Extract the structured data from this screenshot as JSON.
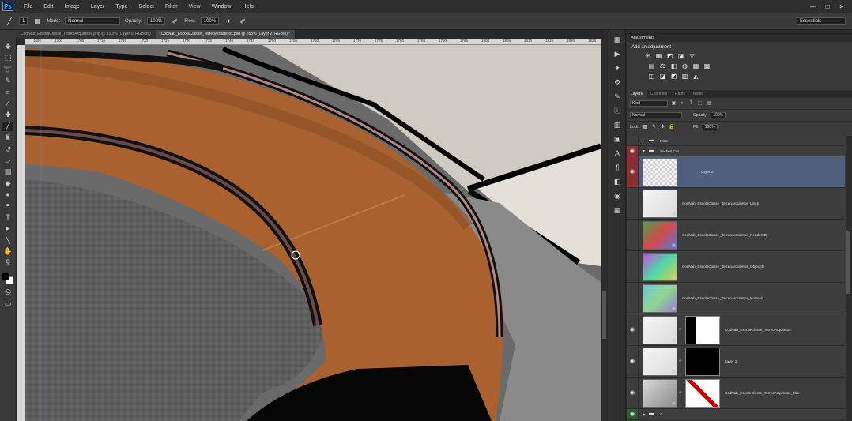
{
  "app": {
    "logo": "Ps",
    "menu": [
      "File",
      "Edit",
      "Image",
      "Layer",
      "Type",
      "Select",
      "Filter",
      "View",
      "Window",
      "Help"
    ],
    "window_controls": [
      "—",
      "□",
      "✕"
    ]
  },
  "options_bar": {
    "brush_size": "1",
    "mode_label": "Mode:",
    "mode_value": "Normal",
    "opacity_label": "Opacity:",
    "opacity_value": "100%",
    "flow_label": "Flow:",
    "flow_value": "100%",
    "workspace": "Essentials"
  },
  "tabs": [
    {
      "label": "CodNab_EscolaClasse_TerreoArquitetos.png @ 33.3% (Layer 0, RGB/8#)",
      "active": false
    },
    {
      "label": "CodNab_EscolaClasse_TerreoArquitetos.psd @ 855% (Layer 2, RGB/8) *",
      "active": true
    }
  ],
  "ruler_ticks": [
    "1695",
    "1700",
    "1705",
    "1710",
    "1715",
    "1720",
    "1725",
    "1730",
    "1735",
    "1740",
    "1745",
    "1750",
    "1755",
    "1760",
    "1765",
    "1770",
    "1775",
    "1780",
    "1785",
    "1790",
    "1795",
    "1800",
    "1805",
    "1810",
    "1815",
    "1820",
    "1825",
    "1830"
  ],
  "tools": [
    {
      "icon": "move-tool-icon",
      "glyph": "✥"
    },
    {
      "icon": "marquee-tool-icon",
      "glyph": "⬚"
    },
    {
      "icon": "lasso-tool-icon",
      "glyph": "➰"
    },
    {
      "icon": "quick-select-icon",
      "glyph": "✎"
    },
    {
      "icon": "crop-tool-icon",
      "glyph": "⌗"
    },
    {
      "icon": "eyedropper-icon",
      "glyph": "⁄"
    },
    {
      "icon": "healing-brush-icon",
      "glyph": "✚"
    },
    {
      "icon": "brush-tool-icon",
      "glyph": "╱",
      "active": true
    },
    {
      "icon": "clone-stamp-icon",
      "glyph": "♜"
    },
    {
      "icon": "history-brush-icon",
      "glyph": "↺"
    },
    {
      "icon": "eraser-icon",
      "glyph": "▱"
    },
    {
      "icon": "gradient-tool-icon",
      "glyph": "▤"
    },
    {
      "icon": "blur-tool-icon",
      "glyph": "◆"
    },
    {
      "icon": "dodge-tool-icon",
      "glyph": "●"
    },
    {
      "icon": "pen-tool-icon",
      "glyph": "✒"
    },
    {
      "icon": "type-tool-icon",
      "glyph": "T"
    },
    {
      "icon": "path-select-icon",
      "glyph": "▸"
    },
    {
      "icon": "line-tool-icon",
      "glyph": "╲"
    },
    {
      "icon": "hand-tool-icon",
      "glyph": "✋"
    },
    {
      "icon": "zoom-tool-icon",
      "glyph": "⚲"
    }
  ],
  "side_icons": [
    {
      "icon": "history-icon",
      "glyph": "▦"
    },
    {
      "icon": "actions-icon",
      "glyph": "▶"
    },
    {
      "icon": "brush-presets-icon",
      "glyph": "✦"
    },
    {
      "icon": "tool-presets-icon",
      "glyph": "⚙"
    },
    {
      "icon": "brush-panel-icon",
      "glyph": "✎"
    },
    {
      "icon": "info-icon",
      "glyph": "ⓘ"
    },
    {
      "icon": "layer-comps-icon",
      "glyph": "▥"
    },
    {
      "icon": "navigator-icon",
      "glyph": "▣"
    },
    {
      "icon": "character-icon",
      "glyph": "A"
    },
    {
      "icon": "paragraph-icon",
      "glyph": "¶"
    },
    {
      "icon": "styles-icon",
      "glyph": "◧"
    },
    {
      "icon": "clone-source-icon",
      "glyph": "◉"
    },
    {
      "icon": "swatches-icon",
      "glyph": "▦"
    }
  ],
  "adjustments": {
    "title": "Adjustments",
    "subtitle": "Add an adjustment",
    "row1": [
      "☀",
      "▦",
      "◩",
      "◪",
      "▽"
    ],
    "row2": [
      "▤",
      "⚖",
      "◧",
      "◍",
      "▦",
      "▩"
    ],
    "row3": [
      "◫",
      "◪",
      "◩",
      "▥",
      "◭"
    ]
  },
  "layers_panel": {
    "tabs": [
      {
        "label": "Layers",
        "active": true
      },
      {
        "label": "Channels",
        "active": false
      },
      {
        "label": "Paths",
        "active": false
      },
      {
        "label": "Notes",
        "active": false
      }
    ],
    "filter_kind": "Kind",
    "blend_mode": "Normal",
    "opacity_label": "Opacity:",
    "opacity_value": "100%",
    "lock_label": "Lock:",
    "fill_label": "Fill:",
    "fill_value": "100%",
    "layers": [
      {
        "name": "Root",
        "type": "group",
        "visible": false
      },
      {
        "name": "Section Cut",
        "type": "group",
        "visible": true,
        "red": true
      },
      {
        "name": "Layer 2",
        "type": "layer",
        "visible": true,
        "red": true,
        "selected": true,
        "thumb": "checker"
      },
      {
        "name": "CodNab_EscolaClasse_TerreoArquitetos_Lines",
        "type": "layer",
        "visible": false,
        "thumb": "lines"
      },
      {
        "name": "CodNab_EscolaClasse_TerreoArquitetos_Render3D",
        "type": "layer",
        "visible": false,
        "thumb": "render"
      },
      {
        "name": "CodNab_EscolaClasse_TerreoArquitetos_ObjectID",
        "type": "layer",
        "visible": false,
        "thumb": "objectid"
      },
      {
        "name": "CodNab_EscolaClasse_TerreoArquitetos_Normals",
        "type": "layer",
        "visible": false,
        "thumb": "normals"
      },
      {
        "name": "CodNab_EscolaClasse_TerreoArquitetos",
        "type": "masked",
        "visible": true,
        "thumb": "lines",
        "mask": "mask1"
      },
      {
        "name": "Layer 1",
        "type": "masked",
        "visible": true,
        "thumb": "lines",
        "mask": "mask2"
      },
      {
        "name": "CodNab_EscolaClasse_TerreoArquitetos_Flat",
        "type": "masked",
        "visible": true,
        "thumb": "flat",
        "mask": "mask3"
      },
      {
        "name": "c",
        "type": "group",
        "visible": true,
        "green": true
      }
    ]
  },
  "colors": {
    "foreground": "#000000",
    "background": "#ffffff",
    "selected_layer": "#4f607f",
    "visibility_red": "#8a2f2f",
    "brown_surface": "#a8612f"
  }
}
